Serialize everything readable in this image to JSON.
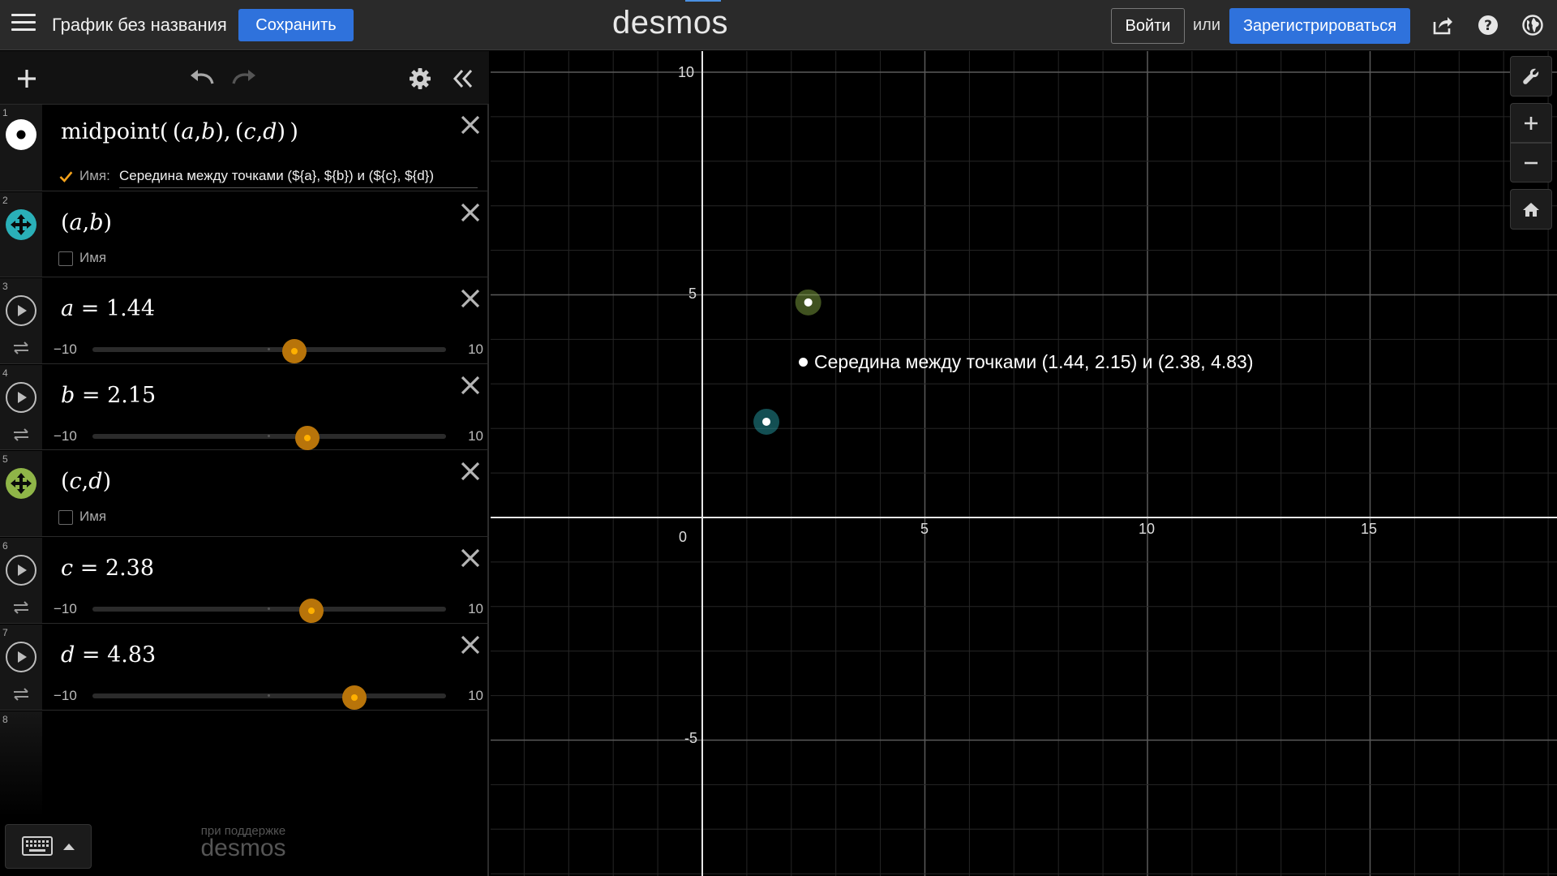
{
  "header": {
    "title": "График без названия",
    "save_label": "Сохранить",
    "logo": "desmos",
    "login_label": "Войти",
    "or_label": "или",
    "signup_label": "Зарегистрироваться",
    "icons": [
      "menu-icon",
      "share-icon",
      "help-icon",
      "globe-icon"
    ]
  },
  "toolbar": {
    "icons": [
      "add-icon",
      "undo-icon",
      "redo-icon",
      "settings-icon",
      "collapse-icon"
    ]
  },
  "expressions": [
    {
      "num": "1",
      "name_label": "Имя:",
      "name_checked": true,
      "label_text": "Середина между точками (${a}, ${b}) и (${c}, ${d})",
      "color": "#ffffff"
    },
    {
      "num": "2",
      "name_label": "Имя",
      "name_checked": false,
      "color": "#2ab0b8"
    },
    {
      "num": "3",
      "var": "a",
      "value": "1.44",
      "min": "−10",
      "max": "10",
      "fraction": 0.572
    },
    {
      "num": "4",
      "var": "b",
      "value": "2.15",
      "min": "−10",
      "max": "10",
      "fraction": 0.6075
    },
    {
      "num": "5",
      "name_label": "Имя",
      "name_checked": false,
      "color": "#8fb548"
    },
    {
      "num": "6",
      "var": "c",
      "value": "2.38",
      "min": "−10",
      "max": "10",
      "fraction": 0.619
    },
    {
      "num": "7",
      "var": "d",
      "value": "4.83",
      "min": "−10",
      "max": "10",
      "fraction": 0.7415
    },
    {
      "num": "8"
    }
  ],
  "footer": {
    "powered_small": "при поддержке",
    "powered_logo": "desmos"
  },
  "graph": {
    "x_ticks": [
      "0",
      "5",
      "10",
      "15"
    ],
    "y_ticks": [
      "10",
      "5",
      "-5"
    ],
    "midpoint_label": "Середина между точками (1.44, 2.15) и (2.38, 4.83)",
    "points": [
      {
        "x": 1.44,
        "y": 2.15,
        "color": "#2ab0b8"
      },
      {
        "x": 2.38,
        "y": 4.83,
        "color": "#8fb548"
      }
    ]
  }
}
